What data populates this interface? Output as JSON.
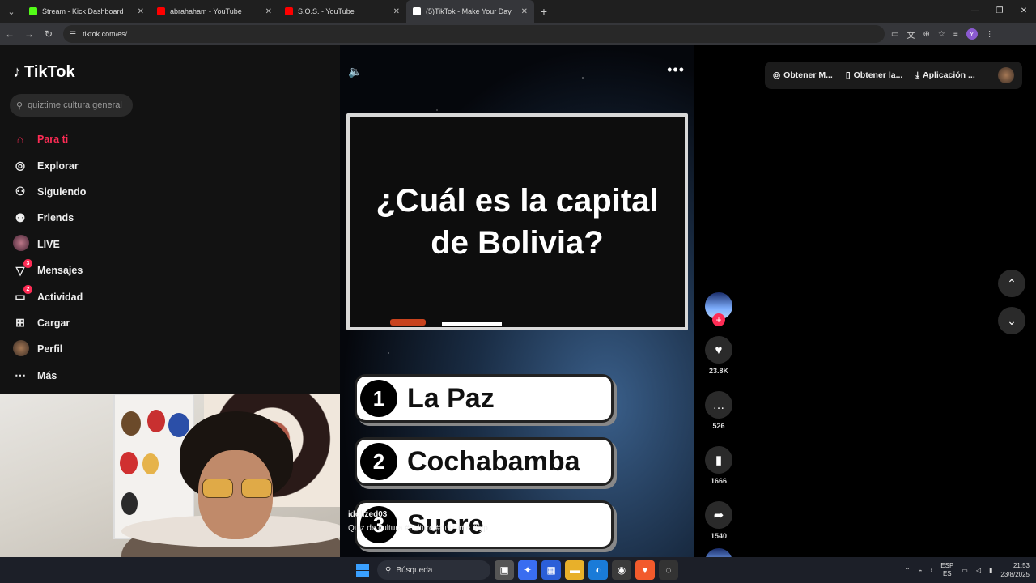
{
  "browser": {
    "tabs": [
      {
        "title": "Stream - Kick Dashboard",
        "color": "#53fc18",
        "active": false
      },
      {
        "title": "abrahaham - YouTube",
        "color": "#ff0000",
        "active": false
      },
      {
        "title": "S.O.S. - YouTube",
        "color": "#ff0000",
        "active": false
      },
      {
        "title": "(5)TikTok - Make Your Day",
        "color": "#ffffff",
        "active": true
      }
    ],
    "url": "tiktok.com/es/"
  },
  "sidebar": {
    "logo": "TikTok",
    "search_placeholder": "quiztime cultura general",
    "items": [
      {
        "label": "Para ti",
        "icon": "home-icon",
        "badge": ""
      },
      {
        "label": "Explorar",
        "icon": "compass-icon",
        "badge": ""
      },
      {
        "label": "Siguiendo",
        "icon": "following-icon",
        "badge": ""
      },
      {
        "label": "Friends",
        "icon": "friends-icon",
        "badge": ""
      },
      {
        "label": "LIVE",
        "icon": "live-icon",
        "badge": ""
      },
      {
        "label": "Mensajes",
        "icon": "messages-icon",
        "badge": "3"
      },
      {
        "label": "Actividad",
        "icon": "activity-icon",
        "badge": "2"
      },
      {
        "label": "Cargar",
        "icon": "upload-icon",
        "badge": ""
      },
      {
        "label": "Perfil",
        "icon": "profile-icon",
        "badge": ""
      },
      {
        "label": "Más",
        "icon": "more-icon",
        "badge": ""
      }
    ]
  },
  "video": {
    "question": "¿Cuál es la capital de Bolivia?",
    "answers": [
      {
        "num": "1",
        "label": "La Paz"
      },
      {
        "num": "2",
        "label": "Cochabamba"
      },
      {
        "num": "3",
        "label": "Sucre"
      }
    ],
    "author": "idolized03",
    "caption": "Quiz de cultura #culture #quiztime #fyp"
  },
  "actions": {
    "likes": "23.8K",
    "comments": "526",
    "saves": "1666",
    "shares": "1540"
  },
  "top_right": {
    "item1": "Obtener M...",
    "item2": "Obtener la...",
    "item3": "Aplicación ..."
  },
  "taskbar": {
    "search": "Búsqueda",
    "lang_top": "ESP",
    "lang_bottom": "ES",
    "time": "21:53",
    "date": "23/8/2025"
  },
  "colors": {
    "accent": "#fe2c55"
  }
}
